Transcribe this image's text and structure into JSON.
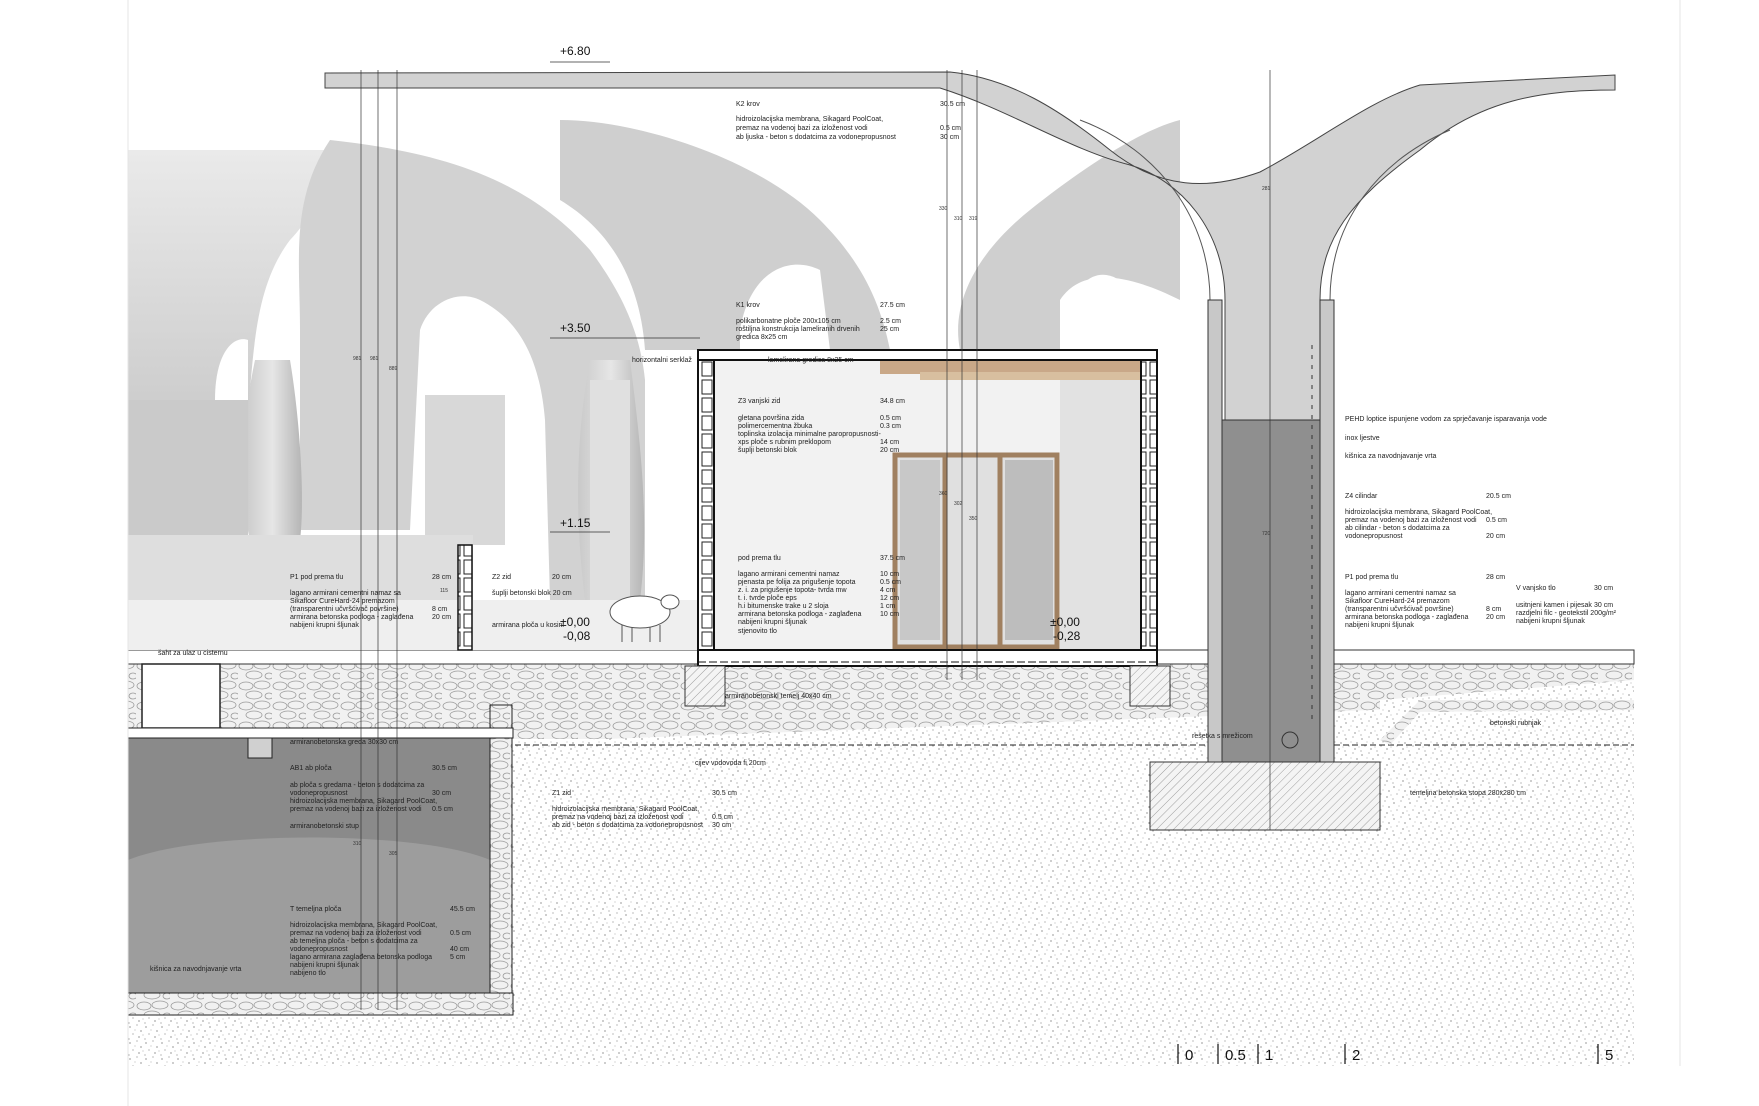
{
  "levels": {
    "roof_top": "+6.80",
    "ceiling": "+3.50",
    "wall_top": "+1.15",
    "floor_zero_left": "±0,00",
    "floor_minus_left": "-0,08",
    "floor_zero_right": "±0,00",
    "floor_minus_right": "-0,28"
  },
  "labels": {
    "k2_roof": {
      "title": "K2 krov",
      "title_val": "30.5 cm",
      "lines": [
        {
          "t": "hidroizolacijska membrana, Sikagard PoolCoat,",
          "v": ""
        },
        {
          "t": "premaz na vodenoj bazi za izloženost vodi",
          "v": "0.5 cm"
        },
        {
          "t": "ab ljuska - beton s dodatcima za vodonepropusnost",
          "v": "30 cm"
        }
      ]
    },
    "k1_roof": {
      "title": "K1 krov",
      "title_val": "27.5 cm",
      "lines": [
        {
          "t": "polikarbonatne ploče 200x105 cm",
          "v": "2.5 cm"
        },
        {
          "t": "roštiljna konstrukcija lameliranih drvenih",
          "v": "25 cm"
        },
        {
          "t": "gredica 8x25 cm",
          "v": ""
        }
      ]
    },
    "horizontal_serklaz": "horizontalni serklaž",
    "lamellar_beam": "lamelirana gredica 8x25 cm",
    "z3_wall": {
      "title": "Z3 vanjski zid",
      "title_val": "34.8 cm",
      "lines": [
        {
          "t": "gletana površina zida",
          "v": "0.5 cm"
        },
        {
          "t": "polimercementna žbuka",
          "v": "0.3 cm"
        },
        {
          "t": "toplinska izolacija minimalne paropropusnosti-",
          "v": ""
        },
        {
          "t": "xps ploče s rubnim preklopom",
          "v": "14 cm"
        },
        {
          "t": "šuplji betonski blok",
          "v": "20 cm"
        }
      ]
    },
    "floor_mid": {
      "title": "pod prema tlu",
      "title_val": "37.5 cm",
      "lines": [
        {
          "t": "lagano armirani cementni namaz",
          "v": "10 cm"
        },
        {
          "t": "pjenasta pe folija za prigušenje topota",
          "v": "0.5 cm"
        },
        {
          "t": "z. i. za prigušenje topota- tvrda mw",
          "v": "4 cm"
        },
        {
          "t": "t. i. tvrde ploče eps",
          "v": "12 cm"
        },
        {
          "t": "h.i bitumenske trake u 2 sloja",
          "v": "1 cm"
        },
        {
          "t": "armirana betonska podloga - zaglađena",
          "v": "10 cm"
        },
        {
          "t": "nabijeni krupni šljunak",
          "v": ""
        },
        {
          "t": "stjenovito tlo",
          "v": ""
        }
      ]
    },
    "p1_left": {
      "title": "P1 pod prema tlu",
      "title_val": "28 cm",
      "lines": [
        {
          "t": "lagano armirani cementni namaz sa",
          "v": ""
        },
        {
          "t": "Sikafloor CureHard-24 premazom",
          "v": ""
        },
        {
          "t": "(transparentni učvršćivač površine)",
          "v": "8 cm"
        },
        {
          "t": "armirana betonska podloga - zaglađena",
          "v": "20 cm"
        },
        {
          "t": "nabijeni krupni šljunak",
          "v": ""
        }
      ]
    },
    "z2_wall": {
      "title": "Z2 zid",
      "title_val": "20 cm",
      "line": "šuplji betonski blok 20 cm"
    },
    "cistern_shaft": "šaht za ulaz u cisternu",
    "rc_slab": "armirana ploča u kosini",
    "rc_footing": "armiranobetonski temelj 40x40 cm",
    "rc_beam": "armiranobetonska greda 30x30 cm",
    "water_pipe": "cijev vodovoda fi 20cm",
    "mesh": "rešetka s mrežicom",
    "ab1": {
      "title": "AB1 ab ploča",
      "title_val": "30.5 cm",
      "lines": [
        {
          "t": "ab ploča s gredama - beton s dodatcima za",
          "v": ""
        },
        {
          "t": "vodonepropusnost",
          "v": "30 cm"
        },
        {
          "t": "hidroizolacijska membrana, Sikagard PoolCoat,",
          "v": ""
        },
        {
          "t": "premaz na vodenoj bazi za izloženost vodi",
          "v": "0.5 cm"
        }
      ]
    },
    "rc_column": "armiranobetonski stup",
    "z1": {
      "title": "Z1 zid",
      "title_val": "30.5 cm",
      "lines": [
        {
          "t": "hidroizolacijska membrana, Sikagard PoolCoat,",
          "v": ""
        },
        {
          "t": "premaz na vodenoj bazi za izloženost vodi",
          "v": "0.5 cm"
        },
        {
          "t": "ab zid - beton s dodatcima za vodonepropusnost",
          "v": "30 cm"
        }
      ]
    },
    "t_slab": {
      "title": "T temeljna ploča",
      "title_val": "45.5 cm",
      "lines": [
        {
          "t": "hidroizolacijska membrana, Sikagard PoolCoat,",
          "v": ""
        },
        {
          "t": "premaz na vodenoj bazi za izloženost vodi",
          "v": "0.5 cm"
        },
        {
          "t": "ab temeljna ploča - beton s dodatcima za",
          "v": ""
        },
        {
          "t": "vodonepropusnost",
          "v": "40 cm"
        },
        {
          "t": "lagano armirana zaglađena betonska podloga",
          "v": "5 cm"
        },
        {
          "t": "nabijeni krupni šljunak",
          "v": ""
        },
        {
          "t": "nabijeno tlo",
          "v": ""
        }
      ]
    },
    "ladder_left": "kišnica za navodnjavanje vrta",
    "pehd": "PEHD loptice ispunjene vodom za sprječavanje isparavanja vode",
    "inox_ladder": "inox ljestve",
    "rainwater_right": "kišnica za navodnjavanje vrta",
    "z4": {
      "title": "Z4 cilindar",
      "title_val": "20.5 cm",
      "lines": [
        {
          "t": "hidroizolacijska membrana, Sikagard PoolCoat,",
          "v": ""
        },
        {
          "t": "premaz na vodenoj bazi za izloženost vodi",
          "v": "0.5 cm"
        },
        {
          "t": "ab cilindar - beton s dodatcima za",
          "v": ""
        },
        {
          "t": "vodonepropusnost",
          "v": "20 cm"
        }
      ]
    },
    "p1_right": {
      "title": "P1 pod prema tlu",
      "title_val": "28 cm",
      "lines": [
        {
          "t": "lagano armirani cementni namaz sa",
          "v": ""
        },
        {
          "t": "Sikafloor CureHard-24 premazom",
          "v": ""
        },
        {
          "t": "(transparentni učvršćivač površine)",
          "v": "8 cm"
        },
        {
          "t": "armirana betonska podloga - zaglađena",
          "v": "20 cm"
        },
        {
          "t": "nabijeni krupni šljunak",
          "v": ""
        }
      ]
    },
    "v_outer": {
      "title": "V vanjsko tlo",
      "title_val": "30 cm",
      "lines": [
        {
          "t": "usitnjeni kamen i pijesak",
          "v": "30 cm"
        },
        {
          "t": "razdjelni filc - geotekstil 200g/m²",
          "v": ""
        },
        {
          "t": "nabijeni krupni šljunak",
          "v": ""
        }
      ]
    },
    "concrete_curb": "betonski rubnjak",
    "footing_right": "temeljna betonska stopa 280x280 cm"
  },
  "dimensions": {
    "d_roof_left_a": "981",
    "d_roof_left_b": "981",
    "d_roof_left_c": "889",
    "d_roof_mid_a": "330",
    "d_roof_mid_b": "310",
    "d_roof_mid_c": "319",
    "d_wall_small": "115",
    "d_room_a": "360",
    "d_room_b": "302",
    "d_room_c": "350",
    "d_column": "281",
    "d_cylinder": "720",
    "d_basement_a": "310",
    "d_basement_b": "305"
  },
  "scale": [
    "0",
    "0.5",
    "1",
    "2",
    "5"
  ],
  "colors": {
    "concrete": "#d6d6d6",
    "concrete_dark": "#b9b9b9",
    "interior": "#f2f2f2",
    "water": "#8f8f8f",
    "basement": "#8a8a8a",
    "timber": "#c9a888",
    "gravel": "#e8e8e8"
  }
}
